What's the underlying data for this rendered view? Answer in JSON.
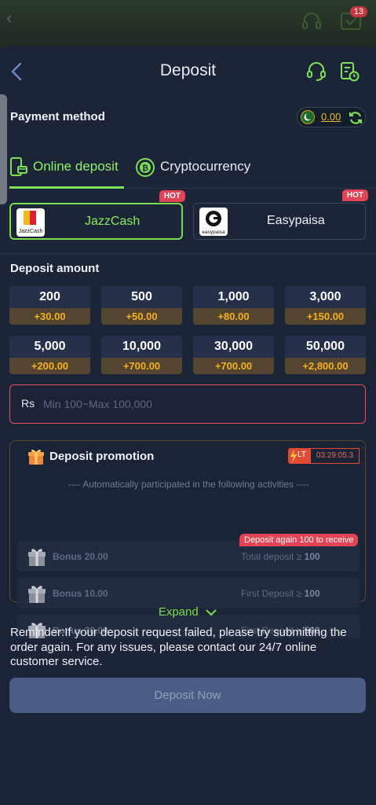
{
  "background": {
    "notification_count": "13"
  },
  "header": {
    "title": "Deposit"
  },
  "payment": {
    "label": "Payment method",
    "balance": "0.00"
  },
  "tabs": [
    {
      "label": "Online deposit",
      "active": true
    },
    {
      "label": "Cryptocurrency",
      "active": false
    }
  ],
  "methods": [
    {
      "name": "JazzCash",
      "badge": "HOT",
      "logo_text": "JazzCash",
      "selected": true
    },
    {
      "name": "Easypaisa",
      "badge": "HOT",
      "logo_text": "easypaisa",
      "selected": false
    }
  ],
  "deposit": {
    "label": "Deposit amount",
    "amounts": [
      {
        "value": "200",
        "bonus": "+30.00"
      },
      {
        "value": "500",
        "bonus": "+50.00"
      },
      {
        "value": "1,000",
        "bonus": "+80.00"
      },
      {
        "value": "3,000",
        "bonus": "+150.00"
      },
      {
        "value": "5,000",
        "bonus": "+200.00"
      },
      {
        "value": "10,000",
        "bonus": "+700.00"
      },
      {
        "value": "30,000",
        "bonus": "+700.00"
      },
      {
        "value": "50,000",
        "bonus": "+2,800.00"
      }
    ],
    "currency": "Rs",
    "placeholder": "Min 100~Max 100,000"
  },
  "promotion": {
    "title": "Deposit promotion",
    "lt_label": "LT",
    "timer": "03:29:05.3",
    "subtitle": "---- Automatically participated in the following activities ----",
    "activities": [
      {
        "name": "Bonus 20.00",
        "condition": "Total deposit ≥",
        "amount": "100",
        "tip": "Deposit again 100 to receive"
      },
      {
        "name": "Bonus 10.00",
        "condition": "First Deposit ≥",
        "amount": "100"
      },
      {
        "name": "Bonus 30.00",
        "condition": "First Deposit ≥",
        "amount": "500"
      }
    ]
  },
  "expand_label": "Expand",
  "reminder": "Reminder:If your deposit request failed, please try submitting the order again. For any issues, please contact our 24/7 online customer service.",
  "submit_label": "Deposit Now",
  "colors": {
    "accent_green": "#7de055",
    "bonus_orange": "#f5b01c",
    "hot_red": "#e24456",
    "background": "#1b2537"
  }
}
